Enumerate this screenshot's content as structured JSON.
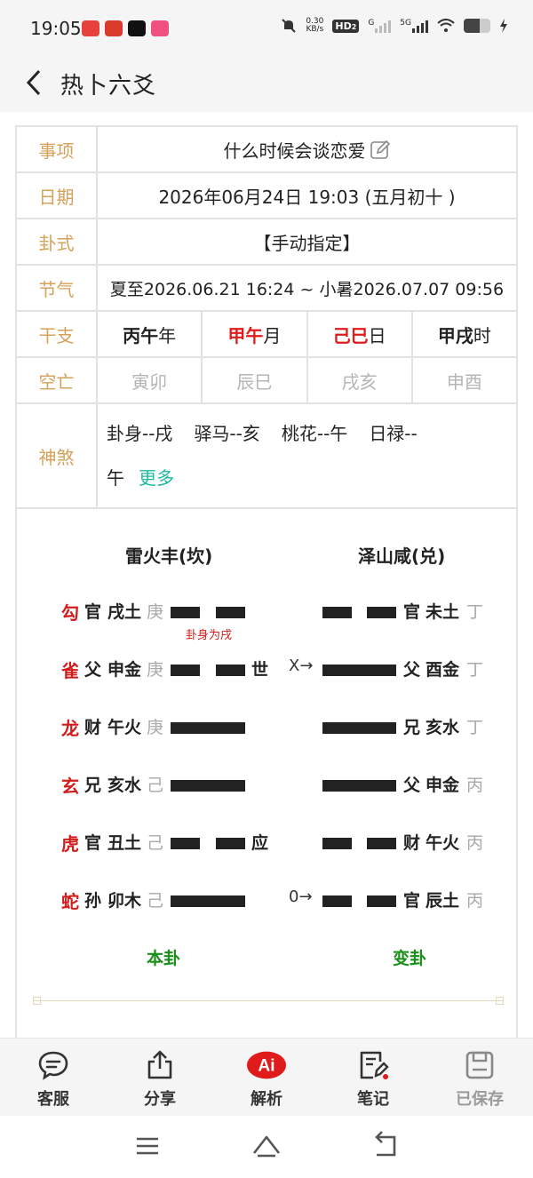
{
  "status_bar": {
    "time": "19:05",
    "net_speed_value": "0.30",
    "net_speed_unit": "KB/s",
    "hd_badge": "HD",
    "hd_sub": "2",
    "sig1_label": "G",
    "sig2_label": "5G",
    "battery_level": 0.6,
    "app_colors": [
      "#e8413c",
      "#d93b2b",
      "#111111",
      "#f0507e"
    ]
  },
  "header": {
    "title": "热卜六爻"
  },
  "info": {
    "labels": {
      "item": "事项",
      "date": "日期",
      "gua_method": "卦式",
      "solar_term": "节气",
      "ganzhi": "干支",
      "kongwang": "空亡",
      "shensha": "神煞"
    },
    "item": "什么时候会谈恋爱",
    "date": "2026年06月24日 19:03 (五月初十 )",
    "gua_method": "【手动指定】",
    "solar_term": "夏至2026.06.21 16:24 ~ 小暑2026.07.07 09:56",
    "ganzhi": [
      {
        "gz": "丙午",
        "unit": "年"
      },
      {
        "gz": "甲午",
        "unit": "月"
      },
      {
        "gz": "己巳",
        "unit": "日"
      },
      {
        "gz": "甲戌",
        "unit": "时"
      }
    ],
    "kongwang": [
      "寅卯",
      "辰巳",
      "戌亥",
      "申酉"
    ],
    "shensha": {
      "s1": "卦身--戌",
      "s2": "驿马--亥",
      "s3": "桃花--午",
      "s4a": "日禄--",
      "s4b": "午",
      "more": "更多"
    }
  },
  "hexagram": {
    "main_title": "雷火丰(坎)",
    "change_title": "泽山咸(兑)",
    "main_label": "本卦",
    "change_label": "变卦",
    "note": "卦身为戌",
    "lines": [
      {
        "god": "勾",
        "rel": "官",
        "branch": "戌土",
        "stem": "庚",
        "main_yin": true,
        "shiying": "",
        "move": "",
        "c_yin": true,
        "c_rel": "官",
        "c_branch": "未土",
        "c_stem": "丁"
      },
      {
        "god": "雀",
        "rel": "父",
        "branch": "申金",
        "stem": "庚",
        "main_yin": true,
        "shiying": "世",
        "move": "X→",
        "c_yin": false,
        "c_rel": "父",
        "c_branch": "酉金",
        "c_stem": "丁"
      },
      {
        "god": "龙",
        "rel": "财",
        "branch": "午火",
        "stem": "庚",
        "main_yin": false,
        "shiying": "",
        "move": "",
        "c_yin": false,
        "c_rel": "兄",
        "c_branch": "亥水",
        "c_stem": "丁"
      },
      {
        "god": "玄",
        "rel": "兄",
        "branch": "亥水",
        "stem": "己",
        "main_yin": false,
        "shiying": "",
        "move": "",
        "c_yin": false,
        "c_rel": "父",
        "c_branch": "申金",
        "c_stem": "丙"
      },
      {
        "god": "虎",
        "rel": "官",
        "branch": "丑土",
        "stem": "己",
        "main_yin": true,
        "shiying": "应",
        "move": "",
        "c_yin": true,
        "c_rel": "财",
        "c_branch": "午火",
        "c_stem": "丙"
      },
      {
        "god": "蛇",
        "rel": "孙",
        "branch": "卯木",
        "stem": "己",
        "main_yin": false,
        "shiying": "",
        "move": "0→",
        "c_yin": true,
        "c_rel": "官",
        "c_branch": "辰土",
        "c_stem": "丙"
      }
    ]
  },
  "bottom_nav": [
    {
      "label": "客服",
      "icon": "chat-icon",
      "dim": false
    },
    {
      "label": "分享",
      "icon": "share-icon",
      "dim": false
    },
    {
      "label": "解析",
      "icon": "ai-icon",
      "dim": false
    },
    {
      "label": "笔记",
      "icon": "note-icon",
      "dim": false
    },
    {
      "label": "已保存",
      "icon": "save-icon",
      "dim": true
    }
  ],
  "colors": {
    "label_gold": "#d4a25a",
    "red": "#e01b1b",
    "green": "#1a8f1a",
    "teal": "#1fb8a0"
  }
}
